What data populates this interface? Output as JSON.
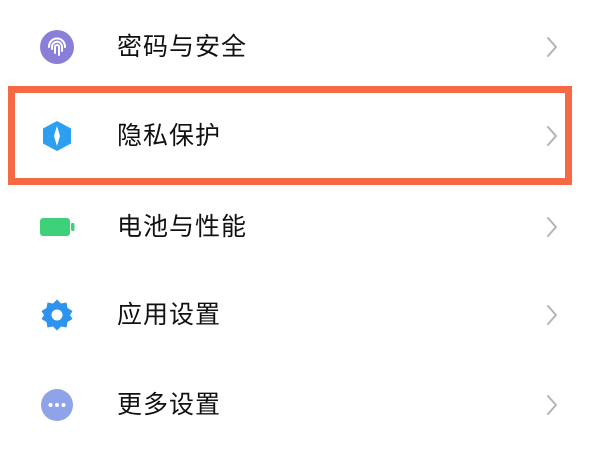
{
  "settings": {
    "items": [
      {
        "label": "密码与安全",
        "icon": "fingerprint-icon",
        "icon_color": "#8a7fd8"
      },
      {
        "label": "隐私保护",
        "icon": "privacy-shield-icon",
        "icon_color": "#2d9ff0"
      },
      {
        "label": "电池与性能",
        "icon": "battery-icon",
        "icon_color": "#3ed17a"
      },
      {
        "label": "应用设置",
        "icon": "gear-icon",
        "icon_color": "#2d93ee"
      },
      {
        "label": "更多设置",
        "icon": "more-dots-icon",
        "icon_color": "#8fa3e8"
      }
    ]
  },
  "highlight": {
    "target": "隐私保护",
    "color": "#f56a45"
  }
}
